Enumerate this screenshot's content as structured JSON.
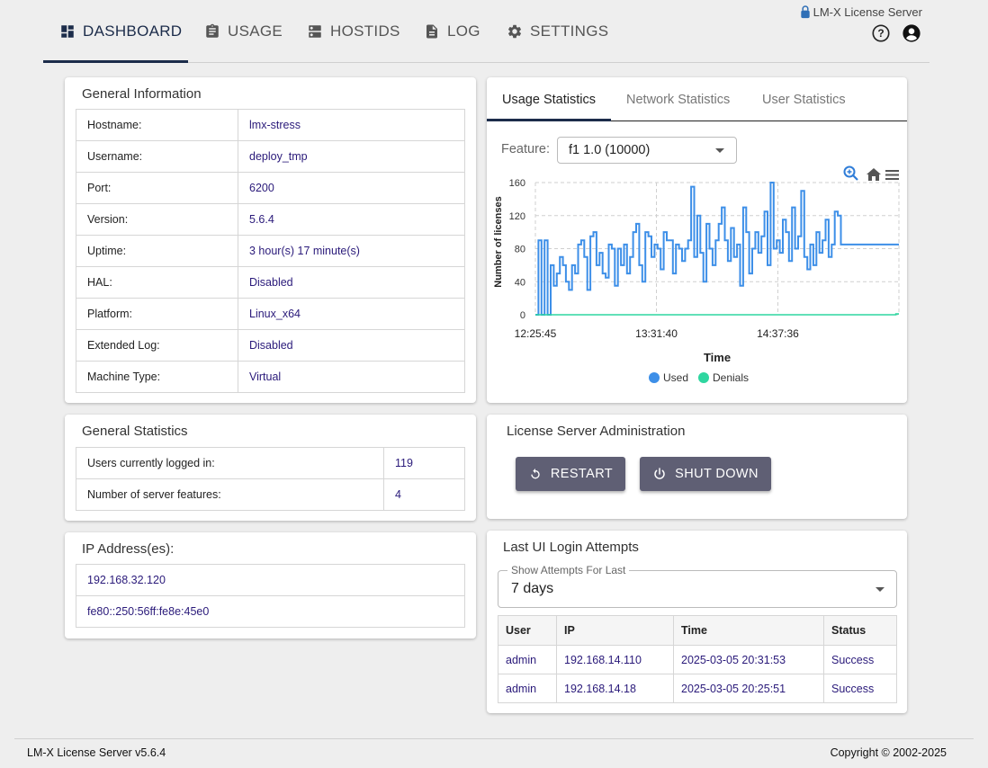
{
  "nav": {
    "tabs": [
      {
        "label": "DASHBOARD",
        "icon": "dashboard-icon"
      },
      {
        "label": "USAGE",
        "icon": "clipboard-icon"
      },
      {
        "label": "HOSTIDS",
        "icon": "server-icon"
      },
      {
        "label": "LOG",
        "icon": "document-icon"
      },
      {
        "label": "SETTINGS",
        "icon": "gear-icon"
      }
    ],
    "brand": "LM-X License Server",
    "accent": "#1c2c4a"
  },
  "general_info": {
    "title": "General Information",
    "rows": [
      {
        "key": "Hostname:",
        "value": "lmx-stress"
      },
      {
        "key": "Username:",
        "value": "deploy_tmp"
      },
      {
        "key": "Port:",
        "value": "6200"
      },
      {
        "key": "Version:",
        "value": "5.6.4"
      },
      {
        "key": "Uptime:",
        "value": "3 hour(s) 17 minute(s)"
      },
      {
        "key": "HAL:",
        "value": "Disabled"
      },
      {
        "key": "Platform:",
        "value": "Linux_x64"
      },
      {
        "key": "Extended Log:",
        "value": "Disabled"
      },
      {
        "key": "Machine Type:",
        "value": "Virtual"
      }
    ]
  },
  "general_stats": {
    "title": "General Statistics",
    "rows": [
      {
        "key": "Users currently logged in:",
        "value": "119"
      },
      {
        "key": "Number of server features:",
        "value": "4"
      }
    ]
  },
  "ip_addresses": {
    "title": "IP Address(es):",
    "items": [
      "192.168.32.120",
      "fe80::250:56ff:fe8e:45e0"
    ]
  },
  "stats_panel": {
    "tabs": [
      "Usage Statistics",
      "Network Statistics",
      "User Statistics"
    ],
    "feature_label": "Feature:",
    "feature_value": "f1 1.0 (10000)"
  },
  "chart_data": {
    "type": "line",
    "xlabel": "Time",
    "ylabel": "Number of licenses",
    "x_ticks": [
      "12:25:45",
      "13:31:40",
      "14:37:36"
    ],
    "y_ticks": [
      0,
      40,
      80,
      120,
      160
    ],
    "ylim": [
      0,
      160
    ],
    "legend_placement": "bottom",
    "series": [
      {
        "name": "Used",
        "color": "#3d8fe8",
        "values": [
          0,
          90,
          0,
          90,
          0,
          60,
          35,
          50,
          70,
          60,
          40,
          30,
          60,
          50,
          85,
          90,
          70,
          30,
          95,
          100,
          60,
          75,
          50,
          45,
          85,
          80,
          35,
          80,
          60,
          85,
          50,
          70,
          100,
          110,
          60,
          40,
          100,
          95,
          70,
          85,
          80,
          55,
          100,
          90,
          90,
          50,
          85,
          80,
          65,
          80,
          90,
          155,
          70,
          120,
          75,
          40,
          110,
          80,
          60,
          90,
          110,
          130,
          90,
          65,
          105,
          70,
          85,
          35,
          130,
          100,
          50,
          80,
          100,
          75,
          95,
          125,
          60,
          160,
          80,
          90,
          75,
          115,
          100,
          65,
          130,
          80,
          95,
          150,
          70,
          55,
          85,
          60,
          100,
          75,
          90,
          115,
          70,
          85,
          125,
          120,
          85,
          85,
          85,
          85,
          85,
          85,
          85,
          85,
          85,
          85,
          85,
          85,
          85,
          85,
          85,
          85,
          85,
          85,
          85,
          85
        ]
      },
      {
        "name": "Denials",
        "color": "#2fd6a0",
        "values": [
          0,
          0,
          0,
          0,
          0,
          0,
          0,
          0,
          0,
          0,
          0,
          0,
          0,
          0,
          0,
          0,
          0,
          0,
          0,
          0,
          0,
          0,
          0,
          0,
          0,
          0,
          0,
          0,
          0,
          0,
          0,
          0,
          0,
          0,
          0,
          0,
          0,
          0,
          0,
          0,
          0,
          0,
          0,
          0,
          0,
          0,
          0,
          0,
          0,
          0,
          0,
          0,
          0,
          0,
          0,
          0,
          0,
          0,
          0,
          0,
          0,
          0,
          0,
          0,
          0,
          0,
          0,
          0,
          0,
          0,
          0,
          0,
          0,
          0,
          0,
          0,
          0,
          0,
          0,
          0,
          0,
          0,
          0,
          0,
          0,
          0,
          0,
          0,
          0,
          0,
          0,
          0,
          0,
          0,
          0,
          0,
          0,
          0,
          0,
          0,
          0,
          0,
          0,
          0,
          0,
          0,
          0,
          0,
          0,
          0,
          0,
          0,
          0,
          0,
          0,
          0,
          0,
          0,
          1,
          1
        ]
      }
    ]
  },
  "admin": {
    "title": "License Server Administration",
    "restart_label": "RESTART",
    "shutdown_label": "SHUT DOWN"
  },
  "login_attempts": {
    "title": "Last UI Login Attempts",
    "filter_label": "Show Attempts For Last",
    "filter_value": "7 days",
    "columns": [
      "User",
      "IP",
      "Time",
      "Status"
    ],
    "rows": [
      {
        "user": "admin",
        "ip": "192.168.14.110",
        "time": "2025-03-05 20:31:53",
        "status": "Success"
      },
      {
        "user": "admin",
        "ip": "192.168.14.18",
        "time": "2025-03-05 20:25:51",
        "status": "Success"
      }
    ]
  },
  "footer": {
    "left": "LM-X License Server v5.6.4",
    "right": "Copyright © 2002-2025"
  }
}
